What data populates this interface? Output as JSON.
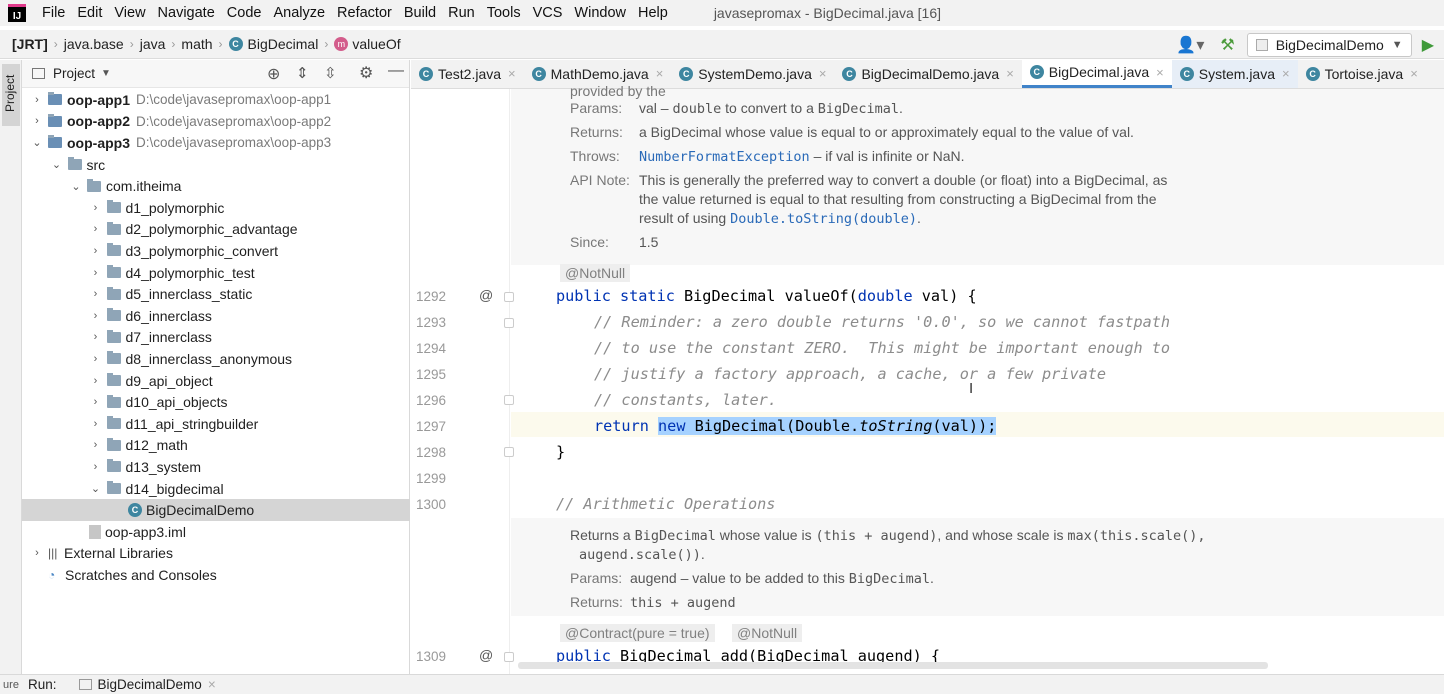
{
  "menubar": {
    "items": [
      "File",
      "Edit",
      "View",
      "Navigate",
      "Code",
      "Analyze",
      "Refactor",
      "Build",
      "Run",
      "Tools",
      "VCS",
      "Window",
      "Help"
    ],
    "window_title": "javasepromax - BigDecimal.java [16]"
  },
  "navbar": {
    "crumbs": [
      "[JRT]",
      "java.base",
      "java",
      "math",
      "BigDecimal",
      "valueOf"
    ],
    "run_config": "BigDecimalDemo"
  },
  "project": {
    "title": "Project",
    "side_tab": "Project",
    "tree": [
      {
        "label": "oop-app1",
        "path": "D:\\code\\javasepromax\\oop-app1",
        "indent": 0,
        "arrow": "›",
        "bold": true
      },
      {
        "label": "oop-app2",
        "path": "D:\\code\\javasepromax\\oop-app2",
        "indent": 0,
        "arrow": "›",
        "bold": true
      },
      {
        "label": "oop-app3",
        "path": "D:\\code\\javasepromax\\oop-app3",
        "indent": 0,
        "arrow": "⌄",
        "bold": true
      },
      {
        "label": "src",
        "path": "",
        "indent": 1,
        "arrow": "⌄"
      },
      {
        "label": "com.itheima",
        "path": "",
        "indent": 2,
        "arrow": "⌄"
      },
      {
        "label": "d1_polymorphic",
        "path": "",
        "indent": 3,
        "arrow": "›"
      },
      {
        "label": "d2_polymorphic_advantage",
        "path": "",
        "indent": 3,
        "arrow": "›"
      },
      {
        "label": "d3_polymorphic_convert",
        "path": "",
        "indent": 3,
        "arrow": "›"
      },
      {
        "label": "d4_polymorphic_test",
        "path": "",
        "indent": 3,
        "arrow": "›"
      },
      {
        "label": "d5_innerclass_static",
        "path": "",
        "indent": 3,
        "arrow": "›"
      },
      {
        "label": "d6_innerclass",
        "path": "",
        "indent": 3,
        "arrow": "›"
      },
      {
        "label": "d7_innerclass",
        "path": "",
        "indent": 3,
        "arrow": "›"
      },
      {
        "label": "d8_innerclass_anonymous",
        "path": "",
        "indent": 3,
        "arrow": "›"
      },
      {
        "label": "d9_api_object",
        "path": "",
        "indent": 3,
        "arrow": "›"
      },
      {
        "label": "d10_api_objects",
        "path": "",
        "indent": 3,
        "arrow": "›"
      },
      {
        "label": "d11_api_stringbuilder",
        "path": "",
        "indent": 3,
        "arrow": "›"
      },
      {
        "label": "d12_math",
        "path": "",
        "indent": 3,
        "arrow": "›"
      },
      {
        "label": "d13_system",
        "path": "",
        "indent": 3,
        "arrow": "›"
      },
      {
        "label": "d14_bigdecimal",
        "path": "",
        "indent": 3,
        "arrow": "⌄"
      },
      {
        "label": "BigDecimalDemo",
        "path": "",
        "indent": 4,
        "arrow": "",
        "kind": "class",
        "selected": true
      },
      {
        "label": "oop-app3.iml",
        "path": "",
        "indent": 2,
        "arrow": "",
        "kind": "file"
      },
      {
        "label": "External Libraries",
        "path": "",
        "indent": 0,
        "arrow": "›",
        "kind": "lib"
      },
      {
        "label": "Scratches and Consoles",
        "path": "",
        "indent": 0,
        "arrow": "",
        "kind": "scratch"
      }
    ]
  },
  "tabs": [
    {
      "label": "Test2.java",
      "state": ""
    },
    {
      "label": "MathDemo.java",
      "state": ""
    },
    {
      "label": "SystemDemo.java",
      "state": ""
    },
    {
      "label": "BigDecimalDemo.java",
      "state": ""
    },
    {
      "label": "BigDecimal.java",
      "state": "active"
    },
    {
      "label": "System.java",
      "state": "hl"
    },
    {
      "label": "Tortoise.java",
      "state": ""
    }
  ],
  "doc1": {
    "params_label": "Params:",
    "params_name": "val",
    "params_rest1": " – ",
    "params_code": "double",
    "params_rest2": " to convert to a ",
    "params_code2": "BigDecimal",
    "params_end": ".",
    "returns_label": "Returns:",
    "returns_text": "a BigDecimal whose value is equal to or approximately equal to the value of val.",
    "throws_label": "Throws:",
    "throws_link": "NumberFormatException",
    "throws_text": " – if val is infinite or NaN.",
    "apinote_label": "API Note:",
    "apinote_1": "This is generally the preferred way to convert a double (or float) into a BigDecimal, as",
    "apinote_2": "the value returned is equal to that resulting from constructing a BigDecimal from the",
    "apinote_3a": "result of using ",
    "apinote_3b": "Double.toString(double)",
    "apinote_3c": ".",
    "since_label": "Since:",
    "since_value": "1.5"
  },
  "annotations": {
    "notnull": "@NotNull",
    "contract": "@Contract(pure = true)",
    "notnull2": "@NotNull"
  },
  "code": {
    "lines": [
      "1292",
      "1293",
      "1294",
      "1295",
      "1296",
      "1297",
      "1298",
      "1299",
      "1300",
      "1309"
    ],
    "l1292_kw": "public static",
    "l1292_rest": " BigDecimal valueOf(",
    "l1292_kw2": "double",
    "l1292_end": " val) {",
    "l1293": "// Reminder: a zero double returns '0.0', so we cannot fastpath",
    "l1294": "// to use the constant ZERO.  This might be important enough to",
    "l1295": "// justify a factory approach, a cache, or a few private",
    "l1296": "// constants, later.",
    "l1297_kw": "return",
    "l1297_sel_kw": "new",
    "l1297_sel_a": " BigDecimal(Double.",
    "l1297_sel_it": "toString",
    "l1297_sel_b": "(val));",
    "l1298": "}",
    "l1300": "// Arithmetic Operations",
    "l1309_kw": "public",
    "l1309_rest": " BigDecimal add(BigDecimal augend) {"
  },
  "doc2": {
    "line1a": "Returns a ",
    "line1b": "BigDecimal",
    "line1c": " whose value is ",
    "line1d": "(this + augend)",
    "line1e": ", and whose scale is ",
    "line1f": "max(this.scale(),",
    "line2": "augend.scale())",
    "line2end": ".",
    "params_label": "Params:",
    "params_text": "augend – value to be added to this ",
    "params_code": "BigDecimal",
    "params_end": ".",
    "returns_label": "Returns:",
    "returns_code": "this + augend"
  },
  "bottom": {
    "run_label": "Run:",
    "run_tab": "BigDecimalDemo",
    "side_label": "ure"
  },
  "colors": {
    "accent": "#4083c9",
    "selection": "#a6d2ff",
    "keyword": "#0033b3",
    "comment": "#8c8c8c"
  }
}
